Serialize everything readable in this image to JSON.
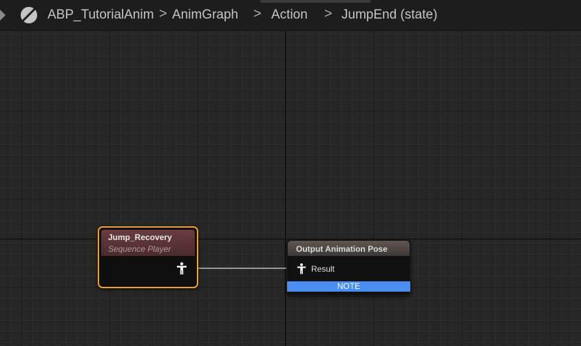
{
  "breadcrumb": {
    "items": [
      {
        "label": "ABP_TutorialAnim"
      },
      {
        "label": "AnimGraph"
      },
      {
        "label": "Action"
      },
      {
        "label": "JumpEnd (state)"
      }
    ],
    "separator": ">"
  },
  "nodes": {
    "sequence_player": {
      "title": "Jump_Recovery",
      "subtitle": "Sequence Player",
      "border_color": "#f2a325",
      "output_pin_icon": "pose-person-icon"
    },
    "output_pose": {
      "title": "Output Animation Pose",
      "result_pin_label": "Result",
      "result_pin_icon": "pose-person-icon",
      "note_label": "NOTE",
      "note_color": "#4a8ef2"
    }
  }
}
